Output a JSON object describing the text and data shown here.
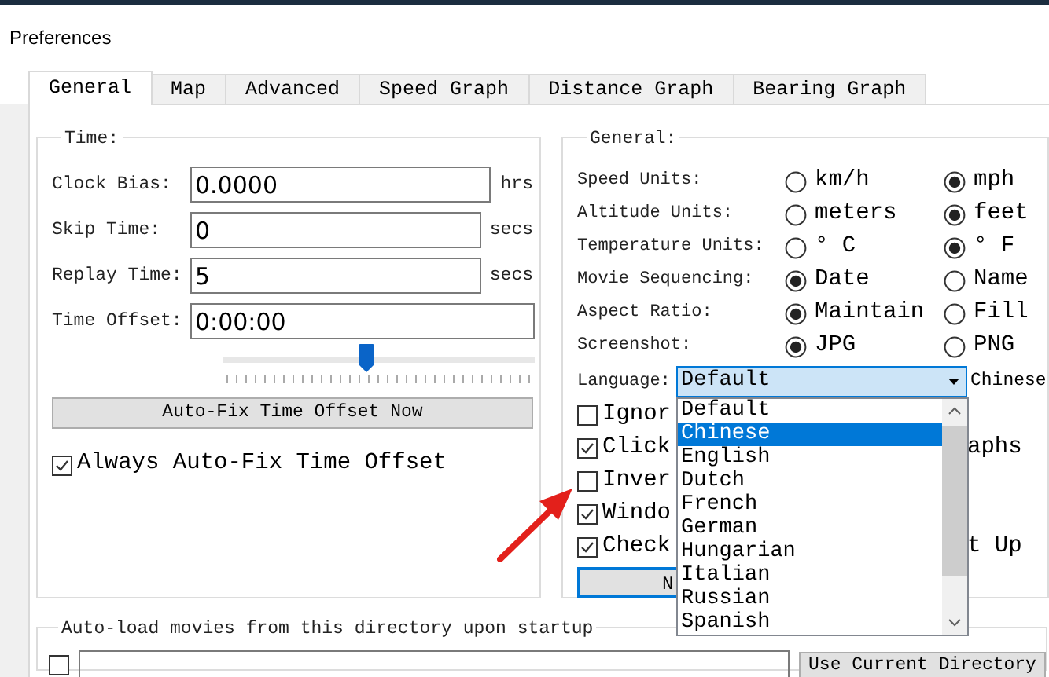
{
  "window": {
    "title": "Preferences"
  },
  "tabs": [
    {
      "label": "General",
      "selected": true
    },
    {
      "label": "Map",
      "selected": false
    },
    {
      "label": "Advanced",
      "selected": false
    },
    {
      "label": "Speed Graph",
      "selected": false
    },
    {
      "label": "Distance Graph",
      "selected": false
    },
    {
      "label": "Bearing Graph",
      "selected": false
    }
  ],
  "time_group": {
    "title": "Time:",
    "fields": [
      {
        "label": "Clock Bias:",
        "value": "0.0000",
        "unit": "hrs"
      },
      {
        "label": "Skip Time:",
        "value": "0",
        "unit": "secs"
      },
      {
        "label": "Replay Time:",
        "value": "5",
        "unit": "secs"
      },
      {
        "label": "Time Offset:",
        "value": "0:00:00"
      }
    ],
    "slider": {
      "level": 0.46
    },
    "button": "Auto-Fix Time Offset Now",
    "checkbox": {
      "label": "Always Auto-Fix Time Offset",
      "checked": true
    }
  },
  "general_group": {
    "title": "General:",
    "radio_rows": [
      {
        "label": "Speed Units:",
        "options": [
          {
            "label": "km/h",
            "selected": false
          },
          {
            "label": "mph",
            "selected": true
          }
        ]
      },
      {
        "label": "Altitude Units:",
        "options": [
          {
            "label": "meters",
            "selected": false
          },
          {
            "label": "feet",
            "selected": true
          }
        ]
      },
      {
        "label": "Temperature Units:",
        "options": [
          {
            "label": "° C",
            "selected": false
          },
          {
            "label": "° F",
            "selected": true
          }
        ]
      },
      {
        "label": "Movie Sequencing:",
        "options": [
          {
            "label": "Date",
            "selected": true
          },
          {
            "label": "Name",
            "selected": false
          }
        ]
      },
      {
        "label": "Aspect Ratio:",
        "options": [
          {
            "label": "Maintain",
            "selected": true
          },
          {
            "label": "Fill",
            "selected": false
          }
        ]
      },
      {
        "label": "Screenshot:",
        "options": [
          {
            "label": "JPG",
            "selected": true
          },
          {
            "label": "PNG",
            "selected": false
          }
        ]
      }
    ],
    "language": {
      "label": "Language:",
      "value": "Default",
      "note": "Chinese"
    },
    "checkboxes": [
      {
        "label": "Ignor",
        "checked": false
      },
      {
        "label": "Click",
        "checked": true,
        "label_end": "aphs"
      },
      {
        "label": "Inver",
        "checked": false
      },
      {
        "label": "Windo",
        "checked": true
      },
      {
        "label": "Check",
        "checked": true,
        "label_end": "t Up"
      }
    ],
    "button": "N"
  },
  "language_dropdown": {
    "items": [
      {
        "label": "Default",
        "selected": false
      },
      {
        "label": "Chinese",
        "selected": true
      },
      {
        "label": "English",
        "selected": false
      },
      {
        "label": "Dutch",
        "selected": false
      },
      {
        "label": "French",
        "selected": false
      },
      {
        "label": "German",
        "selected": false
      },
      {
        "label": "Hungarian",
        "selected": false
      },
      {
        "label": "Italian",
        "selected": false
      },
      {
        "label": "Russian",
        "selected": false
      },
      {
        "label": "Spanish",
        "selected": false
      }
    ]
  },
  "autoload_group": {
    "title": "Auto-load movies from this directory upon startup",
    "checkbox": {
      "checked": false
    },
    "button": "Use Current Directory"
  }
}
